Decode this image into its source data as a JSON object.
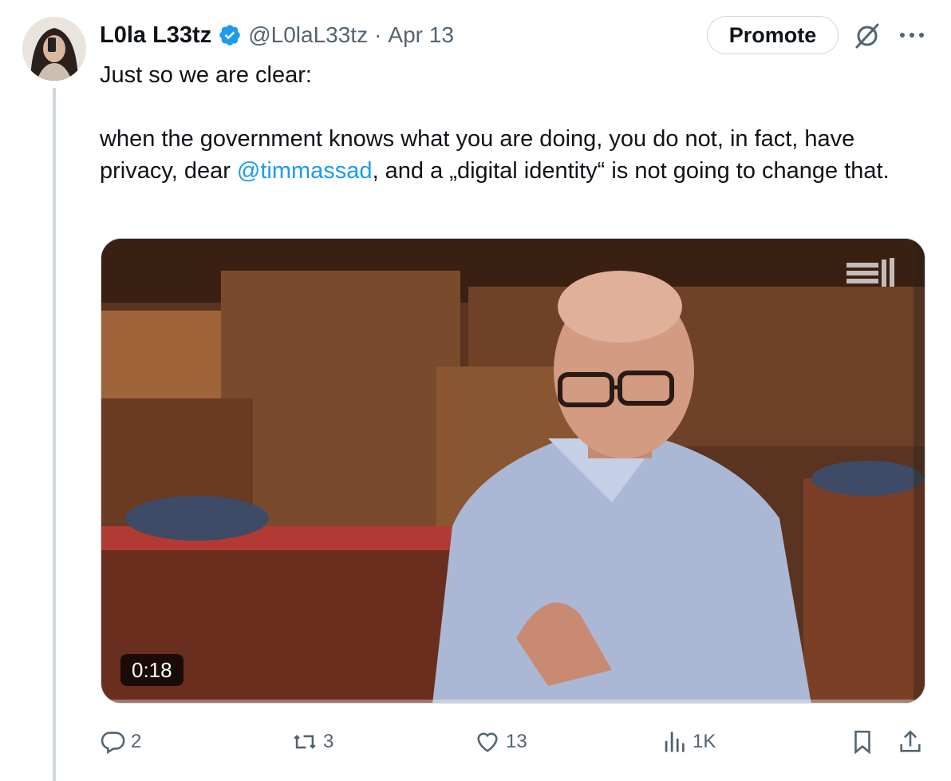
{
  "tweet": {
    "author_name": "L0la L33tz",
    "handle": "@L0laL33tz",
    "separator": "·",
    "date": "Apr 13",
    "text_line1": "Just so we are clear:",
    "text_body_before": "when the government knows what you are doing, you do not, in fact, have privacy, dear ",
    "mention": "@timmassad",
    "text_body_after": ", and a „digital identity“ is not going to change that."
  },
  "header": {
    "promote_label": "Promote",
    "grok_icon": "grok-icon",
    "more_icon": "more-icon"
  },
  "media": {
    "duration": "0:18",
    "logo": "watermark-logo"
  },
  "actions": {
    "replies": "2",
    "reposts": "3",
    "likes": "13",
    "views": "1K"
  },
  "colors": {
    "accent": "#1d9bf0",
    "verified": "#1d9bf0",
    "muted": "#536471",
    "border": "#cfd9de"
  }
}
